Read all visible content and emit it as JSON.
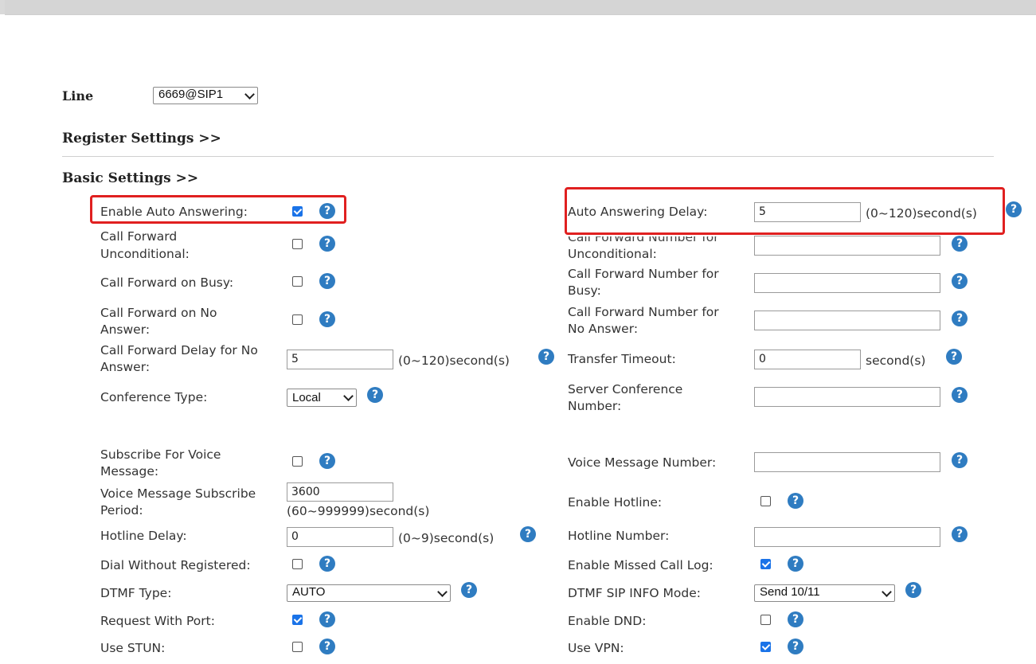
{
  "line": {
    "label": "Line",
    "value": "6669@SIP1"
  },
  "sections": {
    "register": "Register Settings >>",
    "basic": "Basic Settings >>"
  },
  "help_glyph": "?",
  "left": {
    "auto_answer": {
      "label": "Enable Auto Answering:",
      "checked": true
    },
    "cf_uncond": {
      "label1": "Call Forward",
      "label2": "Unconditional:",
      "checked": false
    },
    "cf_busy": {
      "label": "Call Forward on Busy:",
      "checked": false
    },
    "cf_noans": {
      "label1": "Call Forward on No",
      "label2": "Answer:",
      "checked": false
    },
    "cf_delay": {
      "label1": "Call Forward Delay for No",
      "label2": "Answer:",
      "value": "5",
      "unit": "(0~120)second(s)"
    },
    "conf_type": {
      "label": "Conference Type:",
      "value": "Local"
    },
    "subscribe_vm": {
      "label1": "Subscribe For Voice",
      "label2": "Message:",
      "checked": false
    },
    "vm_period": {
      "label1": "Voice Message Subscribe",
      "label2": "Period:",
      "value": "3600",
      "unit": "(60~999999)second(s)"
    },
    "hotline_delay": {
      "label": "Hotline Delay:",
      "value": "0",
      "unit": "(0~9)second(s)"
    },
    "dial_without_reg": {
      "label": "Dial Without Registered:",
      "checked": false
    },
    "dtmf_type": {
      "label": "DTMF Type:",
      "value": "AUTO"
    },
    "req_port": {
      "label": "Request With Port:",
      "checked": true
    },
    "use_stun": {
      "label": "Use STUN:",
      "checked": false
    }
  },
  "right": {
    "auto_answer_delay": {
      "label": "Auto Answering Delay:",
      "value": "5",
      "unit": "(0~120)second(s)"
    },
    "cfn_uncond": {
      "label1": "Call Forward Number for",
      "label2": "Unconditional:",
      "value": ""
    },
    "cfn_busy": {
      "label1": "Call Forward Number for",
      "label2": "Busy:",
      "value": ""
    },
    "cfn_noans": {
      "label1": "Call Forward Number for",
      "label2": "No Answer:",
      "value": ""
    },
    "transfer_timeout": {
      "label": "Transfer Timeout:",
      "value": "0",
      "unit": "second(s)"
    },
    "server_conf": {
      "label1": "Server Conference",
      "label2": "Number:",
      "value": ""
    },
    "vm_number": {
      "label": "Voice Message Number:",
      "value": ""
    },
    "enable_hotline": {
      "label": "Enable Hotline:",
      "checked": false
    },
    "hotline_number": {
      "label": "Hotline Number:",
      "value": ""
    },
    "missed_call_log": {
      "label": "Enable Missed Call Log:",
      "checked": true
    },
    "dtmf_sip_info": {
      "label": "DTMF SIP INFO Mode:",
      "value": "Send 10/11"
    },
    "enable_dnd": {
      "label": "Enable DND:",
      "checked": false
    },
    "use_vpn": {
      "label": "Use VPN:",
      "checked": true
    }
  },
  "colors": {
    "highlight": "#e02020",
    "help": "#2f7cc1",
    "checkbox_on": "#1a73e8"
  }
}
